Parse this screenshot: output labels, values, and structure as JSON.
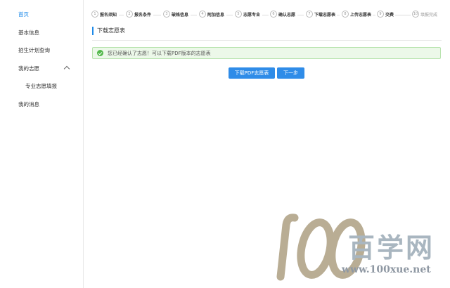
{
  "sidebar": {
    "items": [
      {
        "label": "首页"
      },
      {
        "label": "基本信息"
      },
      {
        "label": "招生计划查询"
      },
      {
        "label": "我的志愿"
      },
      {
        "label": "专业志愿填报"
      },
      {
        "label": "我的消息"
      }
    ]
  },
  "steps": [
    {
      "num": "1",
      "label": "报名须知"
    },
    {
      "num": "2",
      "label": "报名条件"
    },
    {
      "num": "3",
      "label": "破格信息"
    },
    {
      "num": "4",
      "label": "附加信息"
    },
    {
      "num": "5",
      "label": "志愿专业"
    },
    {
      "num": "6",
      "label": "确认志愿"
    },
    {
      "num": "7",
      "label": "下载志愿表"
    },
    {
      "num": "8",
      "label": "上传志愿表"
    },
    {
      "num": "9",
      "label": "交费"
    },
    {
      "num": "10",
      "label": "填报完成"
    }
  ],
  "section_title": "下载志愿表",
  "alert": {
    "message": "您已经确认了志愿！可以下载PDF版本的志愿表"
  },
  "buttons": {
    "download": "下载PDF志愿表",
    "next": "下一步"
  },
  "watermark": {
    "logo": "100",
    "text": "百学网",
    "url": "www.100xue.net"
  },
  "colors": {
    "accent": "#1e8ae8",
    "success": "#52b84a",
    "alert_bg": "#ecf8e9"
  }
}
